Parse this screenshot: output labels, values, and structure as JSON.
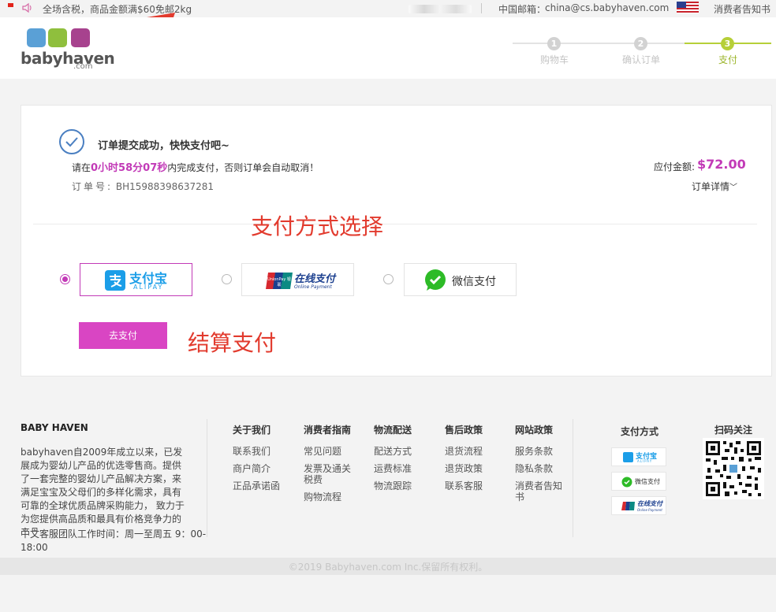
{
  "topbar": {
    "notice": "全场含税，商品金额满$60免邮2kg",
    "mail_label": "中国邮箱：",
    "mail_value": "china@cs.babyhaven.com",
    "notice_link": "消费者告知书"
  },
  "logo": {
    "word": "babyhaven",
    "com": ".com"
  },
  "steps": [
    {
      "num": "1",
      "label": "购物车"
    },
    {
      "num": "2",
      "label": "确认订单"
    },
    {
      "num": "3",
      "label": "支付"
    }
  ],
  "order": {
    "success_title": "订单提交成功，快快支付吧~",
    "countdown_prefix": "请在",
    "countdown_time": "0小时58分07秒",
    "countdown_suffix": "内完成支付，否则订单会自动取消！",
    "order_no_label": "订单号:",
    "order_no": "BH15988398637281",
    "amount_label": "应付金额:",
    "amount_value": "$72.00",
    "detail_link": "订单详情",
    "detail_chevron": "﹀"
  },
  "annotations": {
    "payment_method": "支付方式选择",
    "checkout": "结算支付"
  },
  "payment_methods": [
    {
      "name": "支付宝",
      "sub": "ALIPAY",
      "selected": true
    },
    {
      "name": "在线支付",
      "sub": "Online Payment",
      "brand": "UnionPay 银联",
      "selected": false
    },
    {
      "name": "微信支付",
      "selected": false
    }
  ],
  "go_pay_label": "去支付",
  "footer": {
    "brand": "BABY HAVEN",
    "about": "babyhaven自2009年成立以来，已发展成为婴幼儿产品的优选零售商。提供了一套完整的婴幼儿产品解决方案，来满足宝宝及父母们的多样化需求，具有可靠的全球优质品牌采购能力， 致力于为您提供高品质和最具有价格竞争力的产品。",
    "hours": "中文客服团队工作时间：周一至周五 9：00-18:00",
    "columns": [
      {
        "title": "关于我们",
        "links": [
          "联系我们",
          "商户简介",
          "正品承诺函"
        ]
      },
      {
        "title": "消费者指南",
        "links": [
          "常见问题",
          "发票及通关税费",
          "购物流程"
        ]
      },
      {
        "title": "物流配送",
        "links": [
          "配送方式",
          "运费标准",
          "物流跟踪"
        ]
      },
      {
        "title": "售后政策",
        "links": [
          "退货流程",
          "退货政策",
          "联系客服"
        ]
      },
      {
        "title": "网站政策",
        "links": [
          "服务条款",
          "隐私条款",
          "消费者告知书"
        ]
      }
    ],
    "payment_title": "支付方式",
    "payment_chips": [
      "支付宝",
      "ALIPAY",
      "微信支付",
      "在线支付",
      "Online Payment"
    ],
    "qr_title": "扫码关注",
    "copyright": "©2019 Babyhaven.com Inc.保留所有权利。"
  },
  "colors": {
    "accent": "#c23ab7",
    "button": "#d945c3",
    "annotation": "#e23b2e",
    "step_active": "#b6cf38"
  }
}
